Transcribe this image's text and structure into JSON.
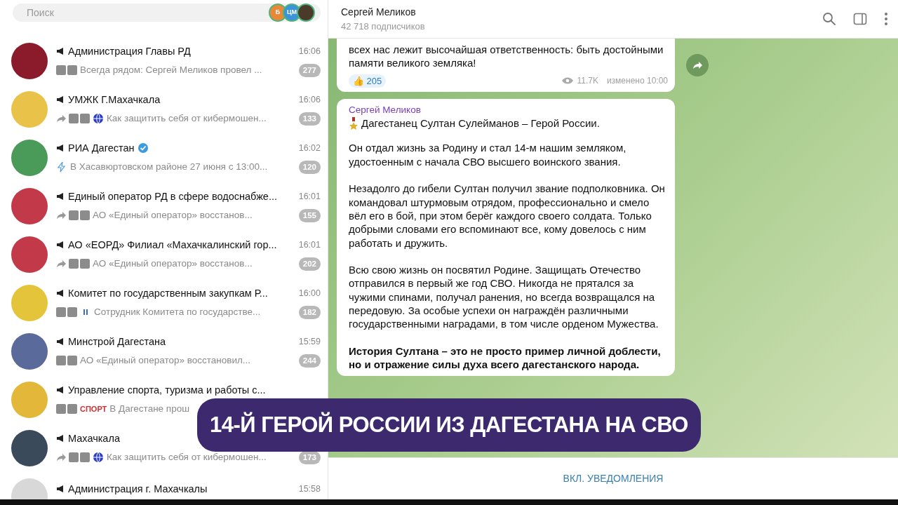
{
  "search": {
    "placeholder": "Поиск",
    "stories": [
      {
        "kind": "letter",
        "text": "Б",
        "color": "#e8893a"
      },
      {
        "kind": "letter",
        "text": "ЦМ",
        "color": "#3b93d9"
      },
      {
        "kind": "photo"
      }
    ]
  },
  "chats": [
    {
      "name": "Администрация Главы РД",
      "time": "16:06",
      "verified": false,
      "forwarded": false,
      "media": true,
      "kind": "plain",
      "preview": "Всегда рядом: Сергей Меликов провел ...",
      "badge": "277",
      "color": "#8b1a2b"
    },
    {
      "name": "УМЖК Г.Махачкала",
      "time": "16:06",
      "verified": false,
      "forwarded": true,
      "media": true,
      "kind": "globe",
      "preview": "Как  защитить  себя от кибермошен...",
      "badge": "133",
      "color": "#e9c24a"
    },
    {
      "name": "РИА Дагестан",
      "time": "16:02",
      "verified": true,
      "forwarded": false,
      "media": false,
      "kind": "bolt",
      "preview": "В Хасавюртовском районе 27 июня с 13:00...",
      "badge": "120",
      "color": "#4a9a5a"
    },
    {
      "name": "Единый оператор РД в сфере водоснабже...",
      "time": "16:01",
      "verified": false,
      "forwarded": true,
      "media": true,
      "kind": "plain",
      "preview": "АО «Единый оператор» восстанов...",
      "badge": "155",
      "color": "#c23a4a"
    },
    {
      "name": "АО «ЕОРД» Филиал «Махачкалинский гор...",
      "time": "16:01",
      "verified": false,
      "forwarded": true,
      "media": true,
      "kind": "plain",
      "preview": "АО «Единый оператор» восстанов...",
      "badge": "202",
      "color": "#c23a4a"
    },
    {
      "name": "Комитет по государственным закупкам Р...",
      "time": "16:00",
      "verified": false,
      "forwarded": false,
      "media": true,
      "kind": "pause",
      "preview": "Сотрудник Комитета по государстве...",
      "badge": "182",
      "color": "#e3c43a"
    },
    {
      "name": "Минстрой Дагестана",
      "time": "15:59",
      "verified": false,
      "forwarded": false,
      "media": true,
      "kind": "plain",
      "preview": "АО «Единый оператор» восстановил...",
      "badge": "244",
      "color": "#5a6a9a"
    },
    {
      "name": "Управление спорта, туризма и работы с...",
      "forwarded": false,
      "verified": false,
      "media": true,
      "kind": "sport",
      "preview_tag": "СПОРТ",
      "preview": "В Дагестане прош",
      "color": "#e3b83a"
    },
    {
      "name": "Махачкала",
      "verified": false,
      "forwarded": true,
      "media": true,
      "kind": "globe",
      "preview": "Как  защитить  себя от кибермошен...",
      "badge": "173",
      "color": "#3a4a5a"
    },
    {
      "name": "Администрация г. Махачкалы",
      "time": "15:58",
      "verified": false,
      "color": "#d8d8d8"
    }
  ],
  "channel": {
    "title": "Сергей Меликов",
    "subtitle": "42 718 подписчиков"
  },
  "messages": [
    {
      "paragraphs": [
        "всех нас лежит высочайшая ответственность: быть достойными памяти великого земляка!"
      ],
      "reaction": {
        "emoji": "👍",
        "count": "205"
      },
      "views": "11.7K",
      "edited": "изменено 10:00"
    },
    {
      "author": "Сергей Меликов",
      "headline": "Дагестанец Султан Сулейманов – Герой России.",
      "paragraphs": [
        "Он отдал жизнь за Родину и стал 14-м нашим земляком, удостоенным с начала СВО высшего воинского звания.",
        "Незадолго до гибели Султан получил звание подполковника. Он командовал штурмовым отрядом, профессионально и смело вёл его в бой, при этом берёг каждого своего солдата. Только добрыми словами его вспоминают все, кому довелось с ним работать и дружить.",
        "Всю свою жизнь он посвятил Родине. Защищать Отечество отправился в первый же год СВО. Никогда не прятался за чужими спинами, получал ранения, но всегда возвращался на передовую. За особые успехи он награждён различными государственными наградами, в том числе орденом Мужества.",
        "**История Султана – это не просто пример личной доблести, но и отражение силы духа всего дагестанского народа.**"
      ]
    }
  ],
  "footer": {
    "button": "ВКЛ. УВЕДОМЛЕНИЯ"
  },
  "caption_banner": "14-Й ГЕРОЙ РОССИИ ИЗ ДАГЕСТАНА НА СВО"
}
